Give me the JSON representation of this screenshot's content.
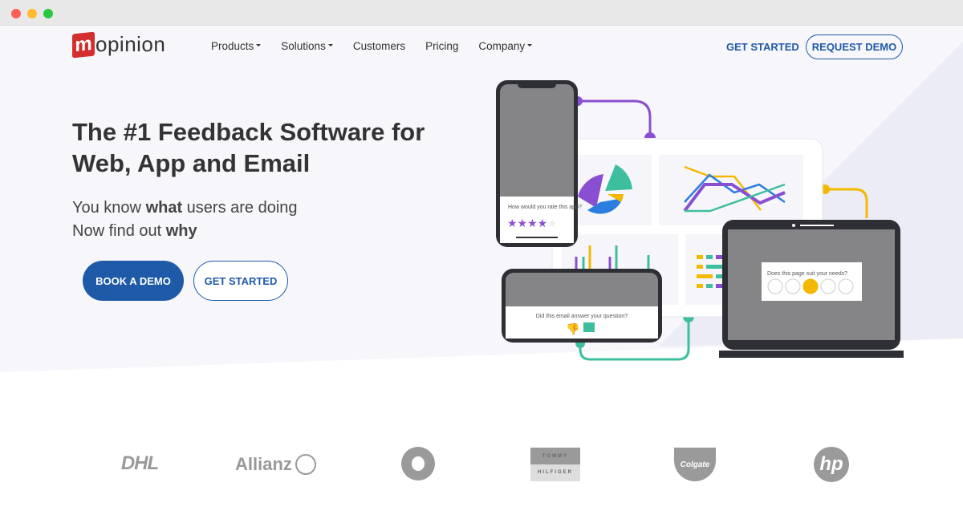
{
  "window": {
    "controls": [
      "close",
      "minimize",
      "maximize"
    ]
  },
  "header": {
    "logo": "mopinion",
    "nav": [
      {
        "label": "Products",
        "dropdown": true
      },
      {
        "label": "Solutions",
        "dropdown": true
      },
      {
        "label": "Customers",
        "dropdown": false
      },
      {
        "label": "Pricing",
        "dropdown": false
      },
      {
        "label": "Company",
        "dropdown": true
      }
    ],
    "get_started": "GET STARTED",
    "request_demo": "REQUEST DEMO"
  },
  "hero": {
    "title": "The #1 Feedback Software for Web, App and Email",
    "line1_pre": "You know ",
    "line1_bold": "what",
    "line1_post": " users are doing",
    "line2_pre": "Now find out ",
    "line2_bold": "why",
    "book_demo": "BOOK A DEMO",
    "get_started": "GET STARTED"
  },
  "illustration": {
    "app_question": "How would you rate this app?",
    "app_rating": 4,
    "app_rating_max": 5,
    "email_question": "Did this email answer your question?",
    "web_question": "Does this page suit your needs?",
    "colors": {
      "purple": "#8a4fd0",
      "teal": "#3dbf9f",
      "yellow": "#f5b800",
      "blue": "#2b7de0",
      "dark": "#2e2e35"
    }
  },
  "customers": [
    "DHL",
    "Allianz",
    "Vodafone",
    "TOMMY HILFIGER",
    "Colgate",
    "hp"
  ],
  "colors": {
    "brand": "#1e5aa8",
    "logo_red": "#d32f2f"
  }
}
